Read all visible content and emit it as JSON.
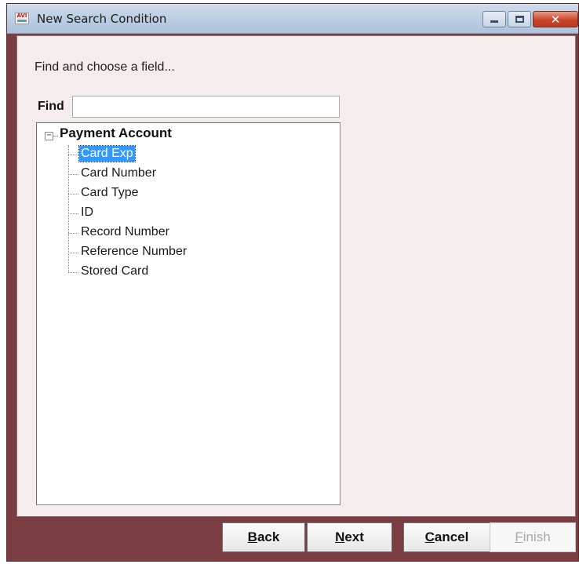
{
  "window": {
    "title": "New Search Condition",
    "app_icon_text": "AVI",
    "controls": {
      "minimize_icon": "minimize-icon",
      "maximize_icon": "maximize-icon",
      "close_icon": "close-icon",
      "close_glyph": "✕"
    }
  },
  "wizard": {
    "prompt": "Find and choose a field...",
    "find": {
      "label": "Find",
      "value": "",
      "placeholder": ""
    },
    "tree": {
      "root": {
        "toggle": "−",
        "label": "Payment Account",
        "expanded": true
      },
      "items": [
        {
          "label": "Card Exp",
          "selected": true
        },
        {
          "label": "Card Number",
          "selected": false
        },
        {
          "label": "Card Type",
          "selected": false
        },
        {
          "label": "ID",
          "selected": false
        },
        {
          "label": "Record Number",
          "selected": false
        },
        {
          "label": "Reference Number",
          "selected": false
        },
        {
          "label": "Stored Card",
          "selected": false
        }
      ]
    }
  },
  "buttons": {
    "back": {
      "accel": "B",
      "rest": "ack",
      "enabled": true
    },
    "next": {
      "accel": "N",
      "rest": "ext",
      "enabled": true
    },
    "cancel": {
      "accel": "C",
      "rest": "ancel",
      "enabled": true
    },
    "finish": {
      "accel": "F",
      "rest": "inish",
      "enabled": false
    }
  },
  "colors": {
    "frame": "#7a3d42",
    "panel": "#f5eced",
    "selection": "#3399ff"
  }
}
